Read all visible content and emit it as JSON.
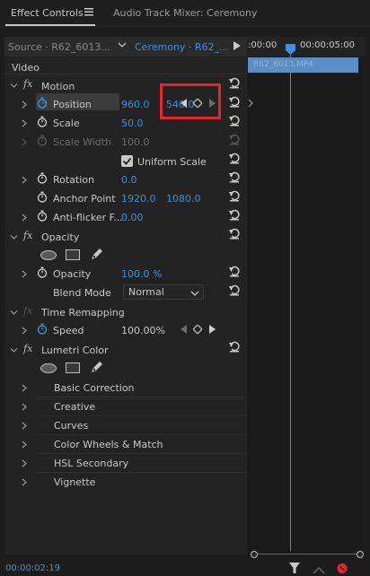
{
  "tabs": {
    "effect_controls": "Effect Controls",
    "audio_mixer": "Audio Track Mixer: Ceremony"
  },
  "source_bar": {
    "source": "Source · R62_6013...",
    "sequence": "Ceremony · R62_..."
  },
  "ruler": {
    "start": ":00:00",
    "end": "00:00:05:00"
  },
  "clip_name": "R62_6013.MP4",
  "section_video": "Video",
  "motion": {
    "label": "Motion",
    "position_label": "Position",
    "position_x": "960.0",
    "position_y": "540.0",
    "scale_label": "Scale",
    "scale_value": "50.0",
    "scale_width_label": "Scale Width",
    "scale_width_value": "100.0",
    "uniform_scale_label": "Uniform Scale",
    "rotation_label": "Rotation",
    "rotation_value": "0.0",
    "anchor_label": "Anchor Point",
    "anchor_x": "1920.0",
    "anchor_y": "1080.0",
    "antiflicker_label": "Anti-flicker F...",
    "antiflicker_value": "0.00"
  },
  "opacity": {
    "label": "Opacity",
    "opacity_label": "Opacity",
    "opacity_value": "100.0 %",
    "blend_label": "Blend Mode",
    "blend_value": "Normal"
  },
  "time_remapping": {
    "label": "Time Remapping",
    "speed_label": "Speed",
    "speed_value": "100.00%"
  },
  "lumetri": {
    "label": "Lumetri Color",
    "items": [
      "Basic Correction",
      "Creative",
      "Curves",
      "Color Wheels & Match",
      "HSL Secondary",
      "Vignette"
    ]
  },
  "timecode": "00:00:02:19",
  "colors": {
    "accent_blue": "#3f8fe0",
    "highlight_red": "#e5262e"
  }
}
